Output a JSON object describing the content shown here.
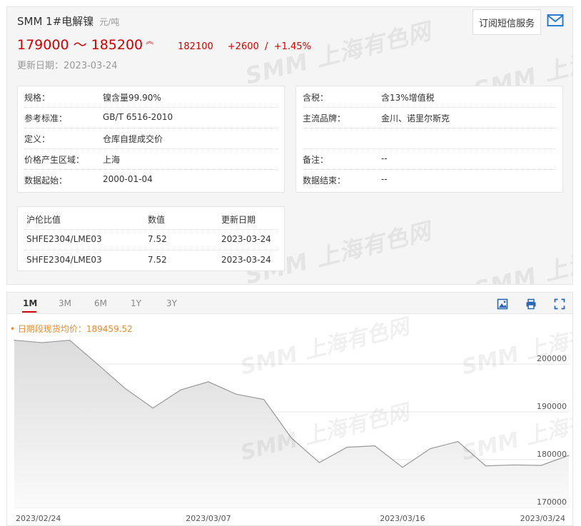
{
  "header": {
    "title": "SMM 1#电解镍",
    "unit": "元/吨",
    "price_range": "179000 ～ 185200",
    "avg_price": "182100",
    "change_abs": "+2600",
    "change_sep": "/",
    "change_pct": "+1.45%",
    "update_date": "更新日期：2023-03-24",
    "subscribe_label": "订阅短信服务",
    "up_icon": "up-arrow-icon",
    "mail_icon": "mail-icon"
  },
  "watermark": {
    "text": "SMM 上海有色网"
  },
  "info_left": [
    {
      "k": "规格：",
      "v": "镍含量99.90%"
    },
    {
      "k": "参考标准：",
      "v": "GB/T 6516-2010"
    },
    {
      "k": "定义：",
      "v": "仓库自提成交价"
    },
    {
      "k": "价格产生区域：",
      "v": "上海"
    },
    {
      "k": "数据起始：",
      "v": "2000-01-04"
    }
  ],
  "info_right": [
    {
      "k": "含税：",
      "v": "含13%增值税"
    },
    {
      "k": "主流品牌：",
      "v": "金川、诺里尔斯克"
    },
    {
      "k": "",
      "v": ""
    },
    {
      "k": "备注：",
      "v": "--"
    },
    {
      "k": "数据结束：",
      "v": "--"
    }
  ],
  "ratio_table": {
    "headers": [
      "沪伦比值",
      "数值",
      "更新日期"
    ],
    "rows": [
      [
        "SHFE2304/LME03",
        "7.52",
        "2023-03-24"
      ],
      [
        "SHFE2304/LME03",
        "7.52",
        "2023-03-24"
      ]
    ]
  },
  "chart_tabs": [
    "1M",
    "3M",
    "6M",
    "1Y",
    "3Y"
  ],
  "active_tab": "1M",
  "toolbar_icons": [
    "image-download-icon",
    "print-icon",
    "fullscreen-icon"
  ],
  "chart_data": {
    "type": "area",
    "legend": "• 日期段现货均价：189459.52",
    "x": [
      "2023/02/24",
      "2023/02/27",
      "2023/02/28",
      "2023/03/01",
      "2023/03/02",
      "2023/03/03",
      "2023/03/06",
      "2023/03/07",
      "2023/03/08",
      "2023/03/09",
      "2023/03/10",
      "2023/03/13",
      "2023/03/14",
      "2023/03/15",
      "2023/03/16",
      "2023/03/17",
      "2023/03/20",
      "2023/03/21",
      "2023/03/22",
      "2023/03/23",
      "2023/03/24"
    ],
    "y": [
      205000,
      204500,
      205000,
      200000,
      194900,
      190800,
      194600,
      196300,
      193700,
      192600,
      184500,
      179400,
      182600,
      182900,
      178400,
      182300,
      183800,
      178700,
      178900,
      178800,
      180900
    ],
    "x_tick_labels": [
      "2023/02/24",
      "2023/03/07",
      "2023/03/16",
      "2023/03/24"
    ],
    "y_ticks": [
      170000,
      180000,
      190000,
      200000
    ],
    "ylim": [
      170000,
      206000
    ],
    "grid": true,
    "line_color": "#999999",
    "fill_color": "#e8e8e8"
  }
}
